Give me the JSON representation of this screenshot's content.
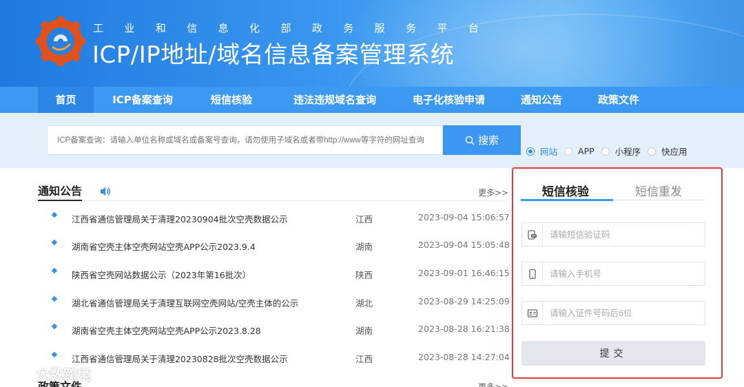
{
  "header": {
    "subtitle_chars": [
      "工",
      "业",
      "和",
      "信",
      "息",
      "化",
      "部",
      "政",
      "务",
      "服",
      "务",
      "平",
      "台"
    ],
    "title": "ICP/IP地址/域名信息备案管理系统"
  },
  "nav": {
    "items": [
      {
        "label": "首页",
        "active": true
      },
      {
        "label": "ICP备案查询",
        "active": false
      },
      {
        "label": "短信核验",
        "active": false
      },
      {
        "label": "违法违规域名查询",
        "active": false
      },
      {
        "label": "电子化核验申请",
        "active": false
      },
      {
        "label": "通知公告",
        "active": false
      },
      {
        "label": "政策文件",
        "active": false
      }
    ]
  },
  "search": {
    "placeholder": "ICP备案查询：请输入单位名称或域名或备案号查询，请勿使用子域名或者带http://www等字符的网址查询",
    "button_label": "搜索",
    "options": [
      {
        "label": "网站",
        "checked": true
      },
      {
        "label": "APP",
        "checked": false
      },
      {
        "label": "小程序",
        "checked": false
      },
      {
        "label": "快应用",
        "checked": false
      }
    ]
  },
  "notices": {
    "title": "通知公告",
    "more": "更多>>",
    "items": [
      {
        "title": "江西省通信管理局关于清理20230904批次空壳数据公示",
        "province": "江西",
        "date": "2023-09-04 15:06:57"
      },
      {
        "title": "湖南省空壳主体空壳网站空壳APP公示2023.9.4",
        "province": "湖南",
        "date": "2023-09-04 15:05:48"
      },
      {
        "title": "陕西省空壳网站数据公示（2023年第16批次）",
        "province": "陕西",
        "date": "2023-09-01 16:46:15"
      },
      {
        "title": "湖北省通信管理局关于清理互联网空壳网站/空壳主体的公示",
        "province": "湖北",
        "date": "2023-08-29 14:25:09"
      },
      {
        "title": "湖南省空壳主体空壳网站空壳APP公示2023.8.28",
        "province": "湖南",
        "date": "2023-08-28 16:21:38"
      },
      {
        "title": "江西省通信管理局关于清理20230828批次空壳数据公示",
        "province": "江西",
        "date": "2023-08-28 14:27:04"
      }
    ]
  },
  "policy": {
    "title": "政策文件",
    "more": "更多>>"
  },
  "sms_panel": {
    "tab_verify": "短信核验",
    "tab_resend": "短信重发",
    "code_placeholder": "请输短信验证码",
    "phone_placeholder": "请输入手机号",
    "id_placeholder": "请输入证件号码后6位",
    "submit_label": "提交"
  },
  "watermark": {
    "text": "大数跨境"
  },
  "colors": {
    "nav_bg": "#3c99f2",
    "nav_active": "#2b86e6",
    "search_button": "#3b97f2",
    "panel_highlight": "#e53a3a"
  }
}
